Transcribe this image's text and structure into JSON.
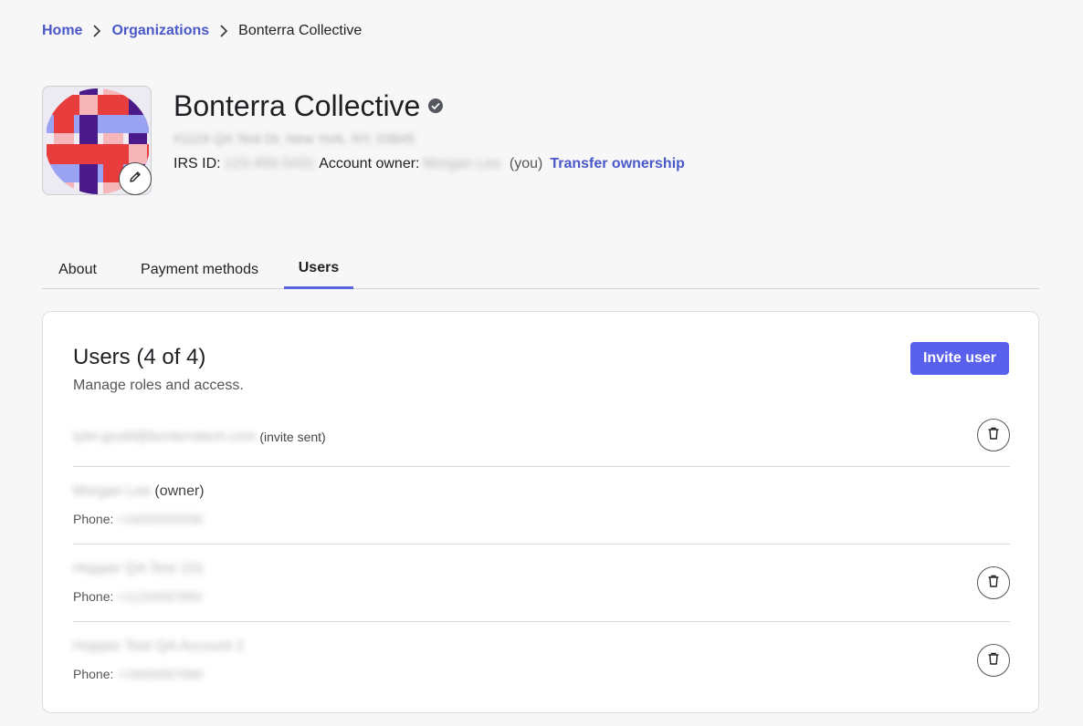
{
  "breadcrumb": {
    "home": "Home",
    "organizations": "Organizations",
    "current": "Bonterra Collective"
  },
  "org": {
    "name": "Bonterra Collective",
    "address": "#1119 QA Test Dr, New York, NY, 03845",
    "irs_label": "IRS ID:",
    "irs_value": "123-456-5431",
    "owner_label": "Account owner:",
    "owner_value": "Morgan Lee",
    "you": "(you)",
    "transfer": "Transfer ownership"
  },
  "tabs": [
    "About",
    "Payment methods",
    "Users"
  ],
  "users_card": {
    "title": "Users (4 of 4)",
    "subtitle": "Manage roles and access.",
    "invite_label": "Invite user",
    "phone_label": "Phone:",
    "users": [
      {
        "name": "tyler.gould@bonterratech.com",
        "tag": "(invite sent)",
        "phone": ""
      },
      {
        "name": "Morgan Lee",
        "tag": "(owner)",
        "phone": "+16055555556"
      },
      {
        "name": "Hopper QA Test 101",
        "tag": "",
        "phone": "+11234567893"
      },
      {
        "name": "Hopper Test QA Account 2",
        "tag": "",
        "phone": "+16059567890"
      }
    ]
  },
  "colors": {
    "link": "#4a58c9",
    "primary_button": "#5960ec",
    "active_tab": "#5b63de"
  },
  "icons": [
    "chevron-right-icon",
    "verified-check-icon",
    "pencil-icon",
    "trash-icon"
  ]
}
